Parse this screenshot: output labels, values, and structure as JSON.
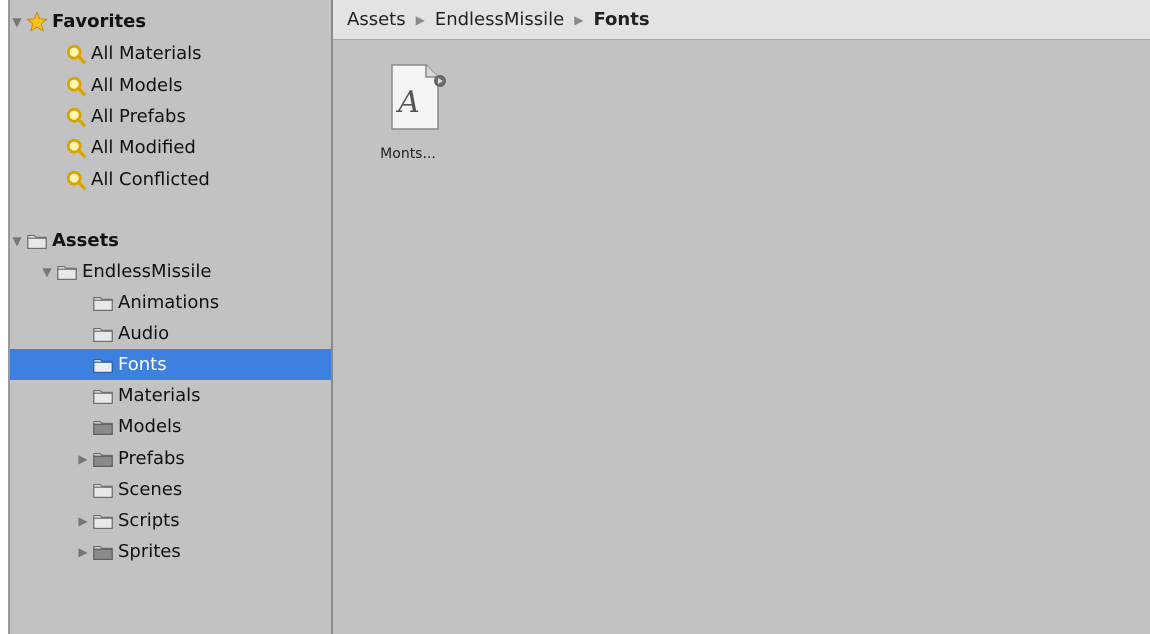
{
  "sidebar": {
    "favorites_label": "Favorites",
    "favorites": [
      {
        "label": "All Materials"
      },
      {
        "label": "All Models"
      },
      {
        "label": "All Prefabs"
      },
      {
        "label": "All Modified"
      },
      {
        "label": "All Conflicted"
      }
    ],
    "assets_label": "Assets",
    "project_folder": "EndlessMissile",
    "folders": [
      {
        "label": "Animations"
      },
      {
        "label": "Audio"
      },
      {
        "label": "Fonts"
      },
      {
        "label": "Materials"
      },
      {
        "label": "Models"
      },
      {
        "label": "Prefabs"
      },
      {
        "label": "Scenes"
      },
      {
        "label": "Scripts"
      },
      {
        "label": "Sprites"
      }
    ]
  },
  "breadcrumb": [
    "Assets",
    "EndlessMissile",
    "Fonts"
  ],
  "assets": [
    {
      "label": "Monts...",
      "icon": "font-asset-icon",
      "glyph": "A"
    }
  ],
  "colors": {
    "selection": "#3d80df",
    "panel": "#c2c2c2",
    "breadcrumb_bar": "#e3e3e3"
  }
}
